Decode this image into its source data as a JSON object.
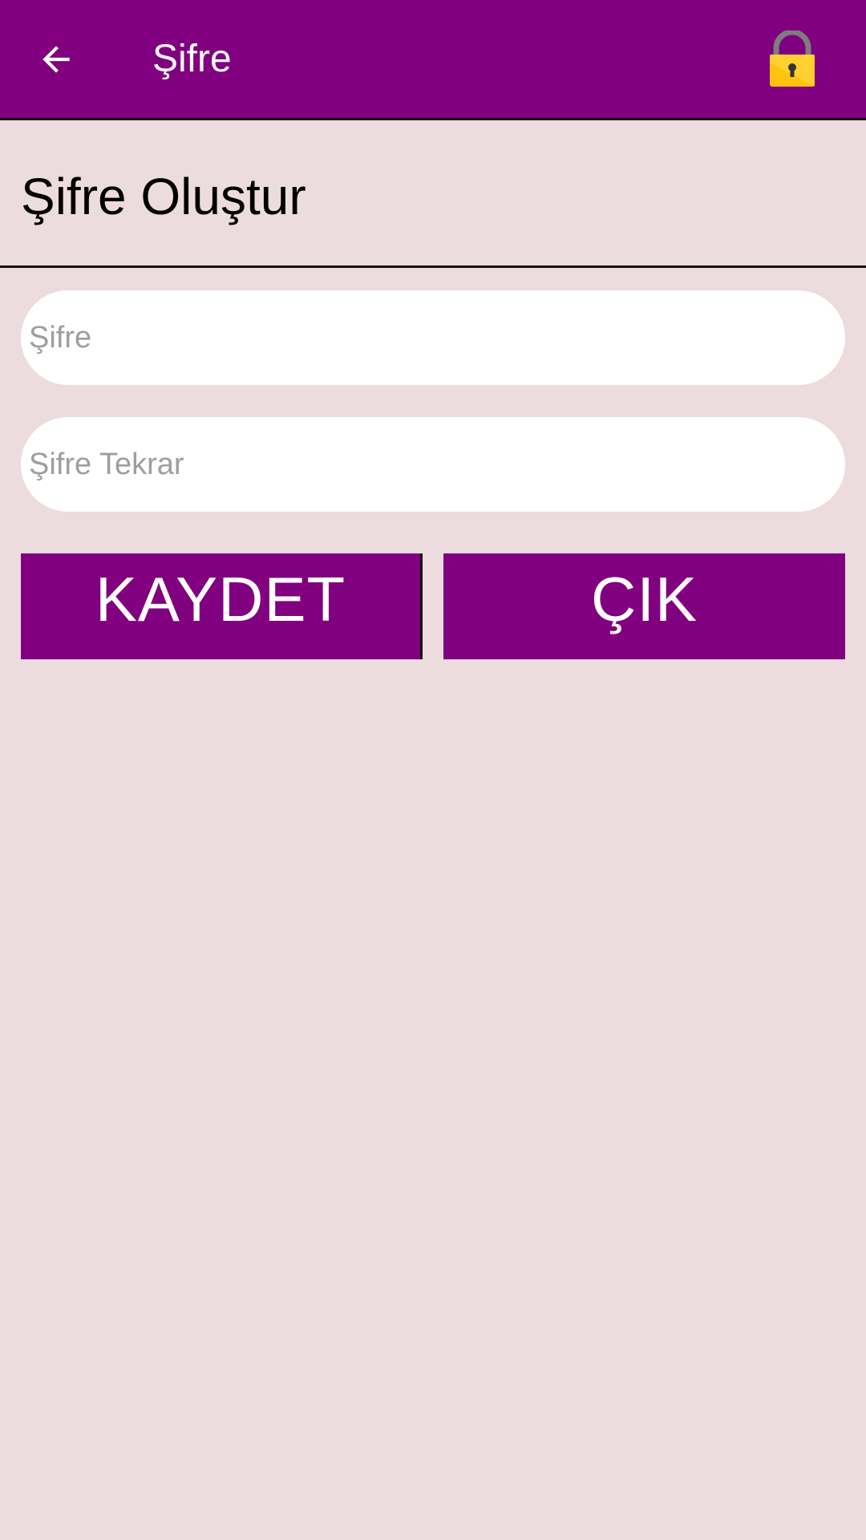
{
  "appbar": {
    "title": "Şifre",
    "back_icon": "arrow-left-icon",
    "action_icon": "lock-icon",
    "background": "#800080"
  },
  "page": {
    "section_title": "Şifre Oluştur",
    "background": "#ecdcdd"
  },
  "form": {
    "password_placeholder": "Şifre",
    "password_value": "",
    "password_repeat_placeholder": "Şifre Tekrar",
    "password_repeat_value": ""
  },
  "buttons": {
    "save_label": "KAYDET",
    "exit_label": "ÇIK",
    "color": "#800080"
  }
}
